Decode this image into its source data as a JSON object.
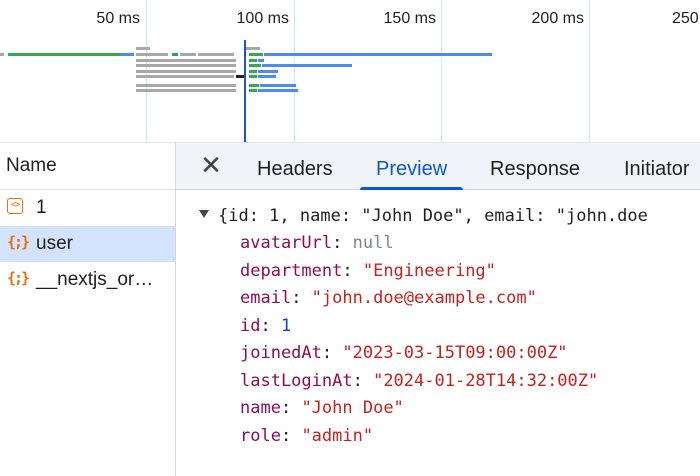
{
  "timeline": {
    "ticks": [
      "50 ms",
      "100 ms",
      "150 ms",
      "200 ms",
      "250"
    ]
  },
  "requests": {
    "header": "Name",
    "items": [
      {
        "label": "1",
        "icon": "document-brackets-icon",
        "selected": false
      },
      {
        "label": "user",
        "icon": "json-braces-icon",
        "selected": true
      },
      {
        "label": "__nextjs_or…",
        "icon": "json-braces-icon",
        "selected": false
      }
    ]
  },
  "details": {
    "close_label": "✕",
    "tabs": [
      "Headers",
      "Preview",
      "Response",
      "Initiator"
    ],
    "active_tab": "Preview"
  },
  "preview": {
    "summary": "{id: 1, name: \"John Doe\", email: \"john.doe",
    "fields": [
      {
        "key": "avatarUrl",
        "value": "null",
        "type": "null"
      },
      {
        "key": "department",
        "value": "\"Engineering\"",
        "type": "string"
      },
      {
        "key": "email",
        "value": "\"john.doe@example.com\"",
        "type": "string"
      },
      {
        "key": "id",
        "value": "1",
        "type": "number"
      },
      {
        "key": "joinedAt",
        "value": "\"2023-03-15T09:00:00Z\"",
        "type": "string"
      },
      {
        "key": "lastLoginAt",
        "value": "\"2024-01-28T14:32:00Z\"",
        "type": "string"
      },
      {
        "key": "name",
        "value": "\"John Doe\"",
        "type": "string"
      },
      {
        "key": "role",
        "value": "\"admin\"",
        "type": "string"
      }
    ]
  },
  "colors": {
    "accent": "#0b57d0",
    "selected_row": "#d3e3fd",
    "json_key": "#8b0d5a",
    "json_string": "#c5221f",
    "json_number": "#1a3ec7",
    "json_null": "#80868b"
  }
}
